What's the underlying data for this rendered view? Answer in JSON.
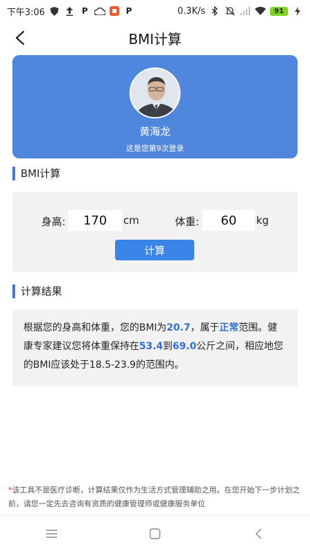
{
  "status_bar": {
    "time": "下午3:06",
    "network_speed": "0.3K/s",
    "battery": "91",
    "left_icons": [
      "shield-icon",
      "upload-icon",
      "p-app-icon",
      "cloud-icon",
      "badge-app-icon",
      "p-app-icon"
    ],
    "right_icons": [
      "bluetooth-icon",
      "mute-icon",
      "signal-icon",
      "wifi-icon",
      "battery-icon",
      "charging-icon"
    ]
  },
  "header": {
    "title": "BMI计算",
    "back_icon": "chevron-left-icon"
  },
  "profile": {
    "name": "黄海龙",
    "login_info": "这是您第9次登录"
  },
  "calculator": {
    "section_title": "BMI计算",
    "height_label": "身高:",
    "height_value": "170",
    "height_unit": "cm",
    "weight_label": "体重:",
    "weight_value": "60",
    "weight_unit": "kg",
    "button_label": "计算"
  },
  "result": {
    "section_title": "计算结果",
    "text_1": "根据您的身高和体重，您的BMI为",
    "bmi": "20.7",
    "text_2": "，属于",
    "category": "正常",
    "text_3": "范围。健康专家建议您将体重保持在",
    "weight_min": "53.4",
    "text_4": "到",
    "weight_max": "69.0",
    "text_5": "公斤之间，相应地您的BMI应该处于18.5-23.9的范围内。"
  },
  "disclaimer": {
    "star": "*",
    "text": "该工具不是医疗诊断，计算结果仅作为生活方式管理辅助之用。在您开始下一步计划之前，请您一定先去咨询有资质的健康管理师或健康服务单位"
  },
  "colors": {
    "card_blue": "#4f87de",
    "button_blue": "#3a86e8",
    "highlight_blue": "#2f6fdc",
    "panel_gray": "#f2f2f2"
  }
}
